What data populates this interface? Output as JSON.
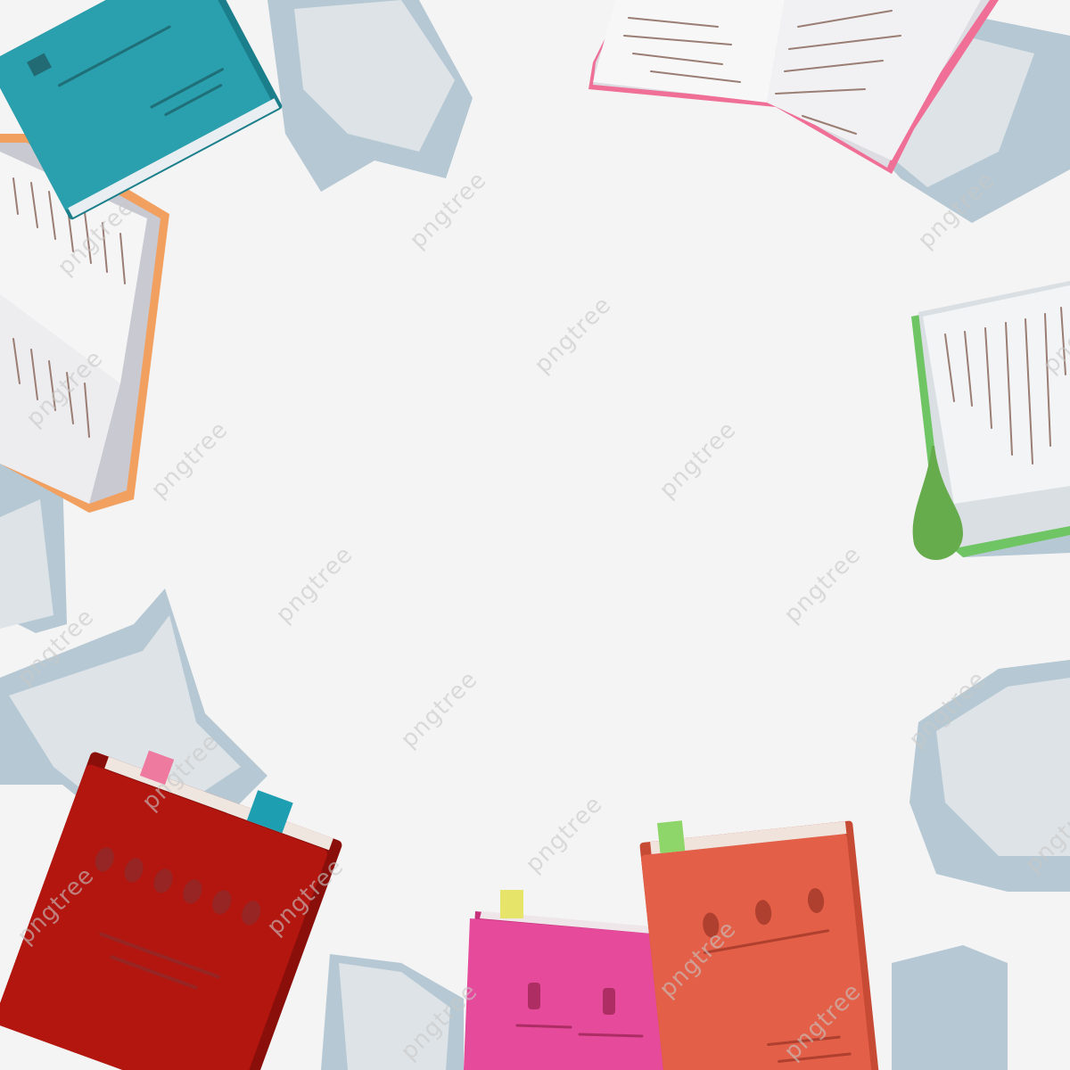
{
  "background_color": "#f4f4f4",
  "watermark": {
    "text": "pngtree"
  },
  "palette": {
    "paper_shadow": "#a9c0cc",
    "paper_light": "#dde3e7",
    "teal_book": "#2a9fad",
    "red_book": "#b3150f",
    "magenta_book": "#e64a9b",
    "orange_book": "#e35f47",
    "pink_edge": "#ef6f97",
    "orange_edge": "#f2a060",
    "green_edge": "#6fc564",
    "tab_pink": "#ef7aa0",
    "tab_teal": "#1e9eb1",
    "tab_yellow": "#e6e56a",
    "tab_green": "#8ed66a"
  },
  "elements": [
    "paper-sheet-icon",
    "teal-closed-book-icon",
    "open-book-icon",
    "bookmark-ribbon-icon",
    "red-book-icon",
    "magenta-book-icon",
    "orange-book-icon",
    "sticky-tab-icon"
  ]
}
